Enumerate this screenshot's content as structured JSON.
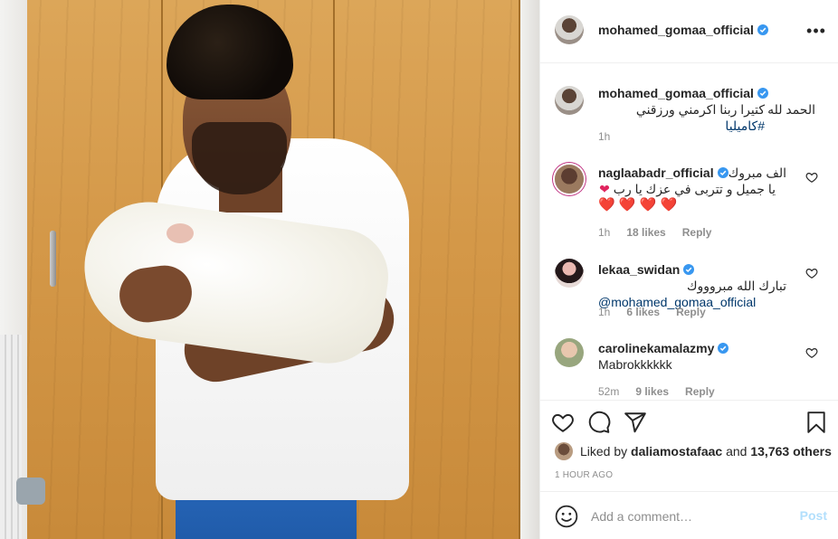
{
  "post": {
    "author": "mohamed_gomaa_official",
    "caption_line1": "الحمد لله",
    "caption_line2": "كتيرا ربنا اكرمني ورزقني",
    "caption_hashtag": "#كاميليا",
    "caption_time": "1h"
  },
  "comments": [
    {
      "user": "naglaabadr_official",
      "line1": "الف مبروك",
      "line2": "يا جميل و تتربى في عزك يا رب",
      "hearts": "❤️ ❤️ ❤️ ❤️",
      "time": "1h",
      "likes": "18 likes",
      "reply": "Reply"
    },
    {
      "user": "lekaa_swidan",
      "line1": "تبارك الله مبروووك",
      "mention": "@mohamed_gomaa_official",
      "time": "1h",
      "likes": "6 likes",
      "reply": "Reply"
    },
    {
      "user": "carolinekamalazmy",
      "line1": "Mabrokkkkkk",
      "time": "52m",
      "likes": "9 likes",
      "reply": "Reply"
    }
  ],
  "likes": {
    "prefix": "Liked by",
    "liker": "daliamostafaac",
    "and": "and",
    "others": "13,763 others"
  },
  "timestamp": "1 HOUR AGO",
  "add_comment": {
    "placeholder": "Add a comment…",
    "post_label": "Post"
  },
  "colors": {
    "verified": "#3897f0",
    "link": "#00376b",
    "muted": "#8e8e8e",
    "post_disabled": "#b2dffc",
    "heart": "#e0245e"
  },
  "icons": [
    "more-icon",
    "verified-icon",
    "heart-icon",
    "comment-icon",
    "share-icon",
    "bookmark-icon",
    "emoji-icon"
  ]
}
